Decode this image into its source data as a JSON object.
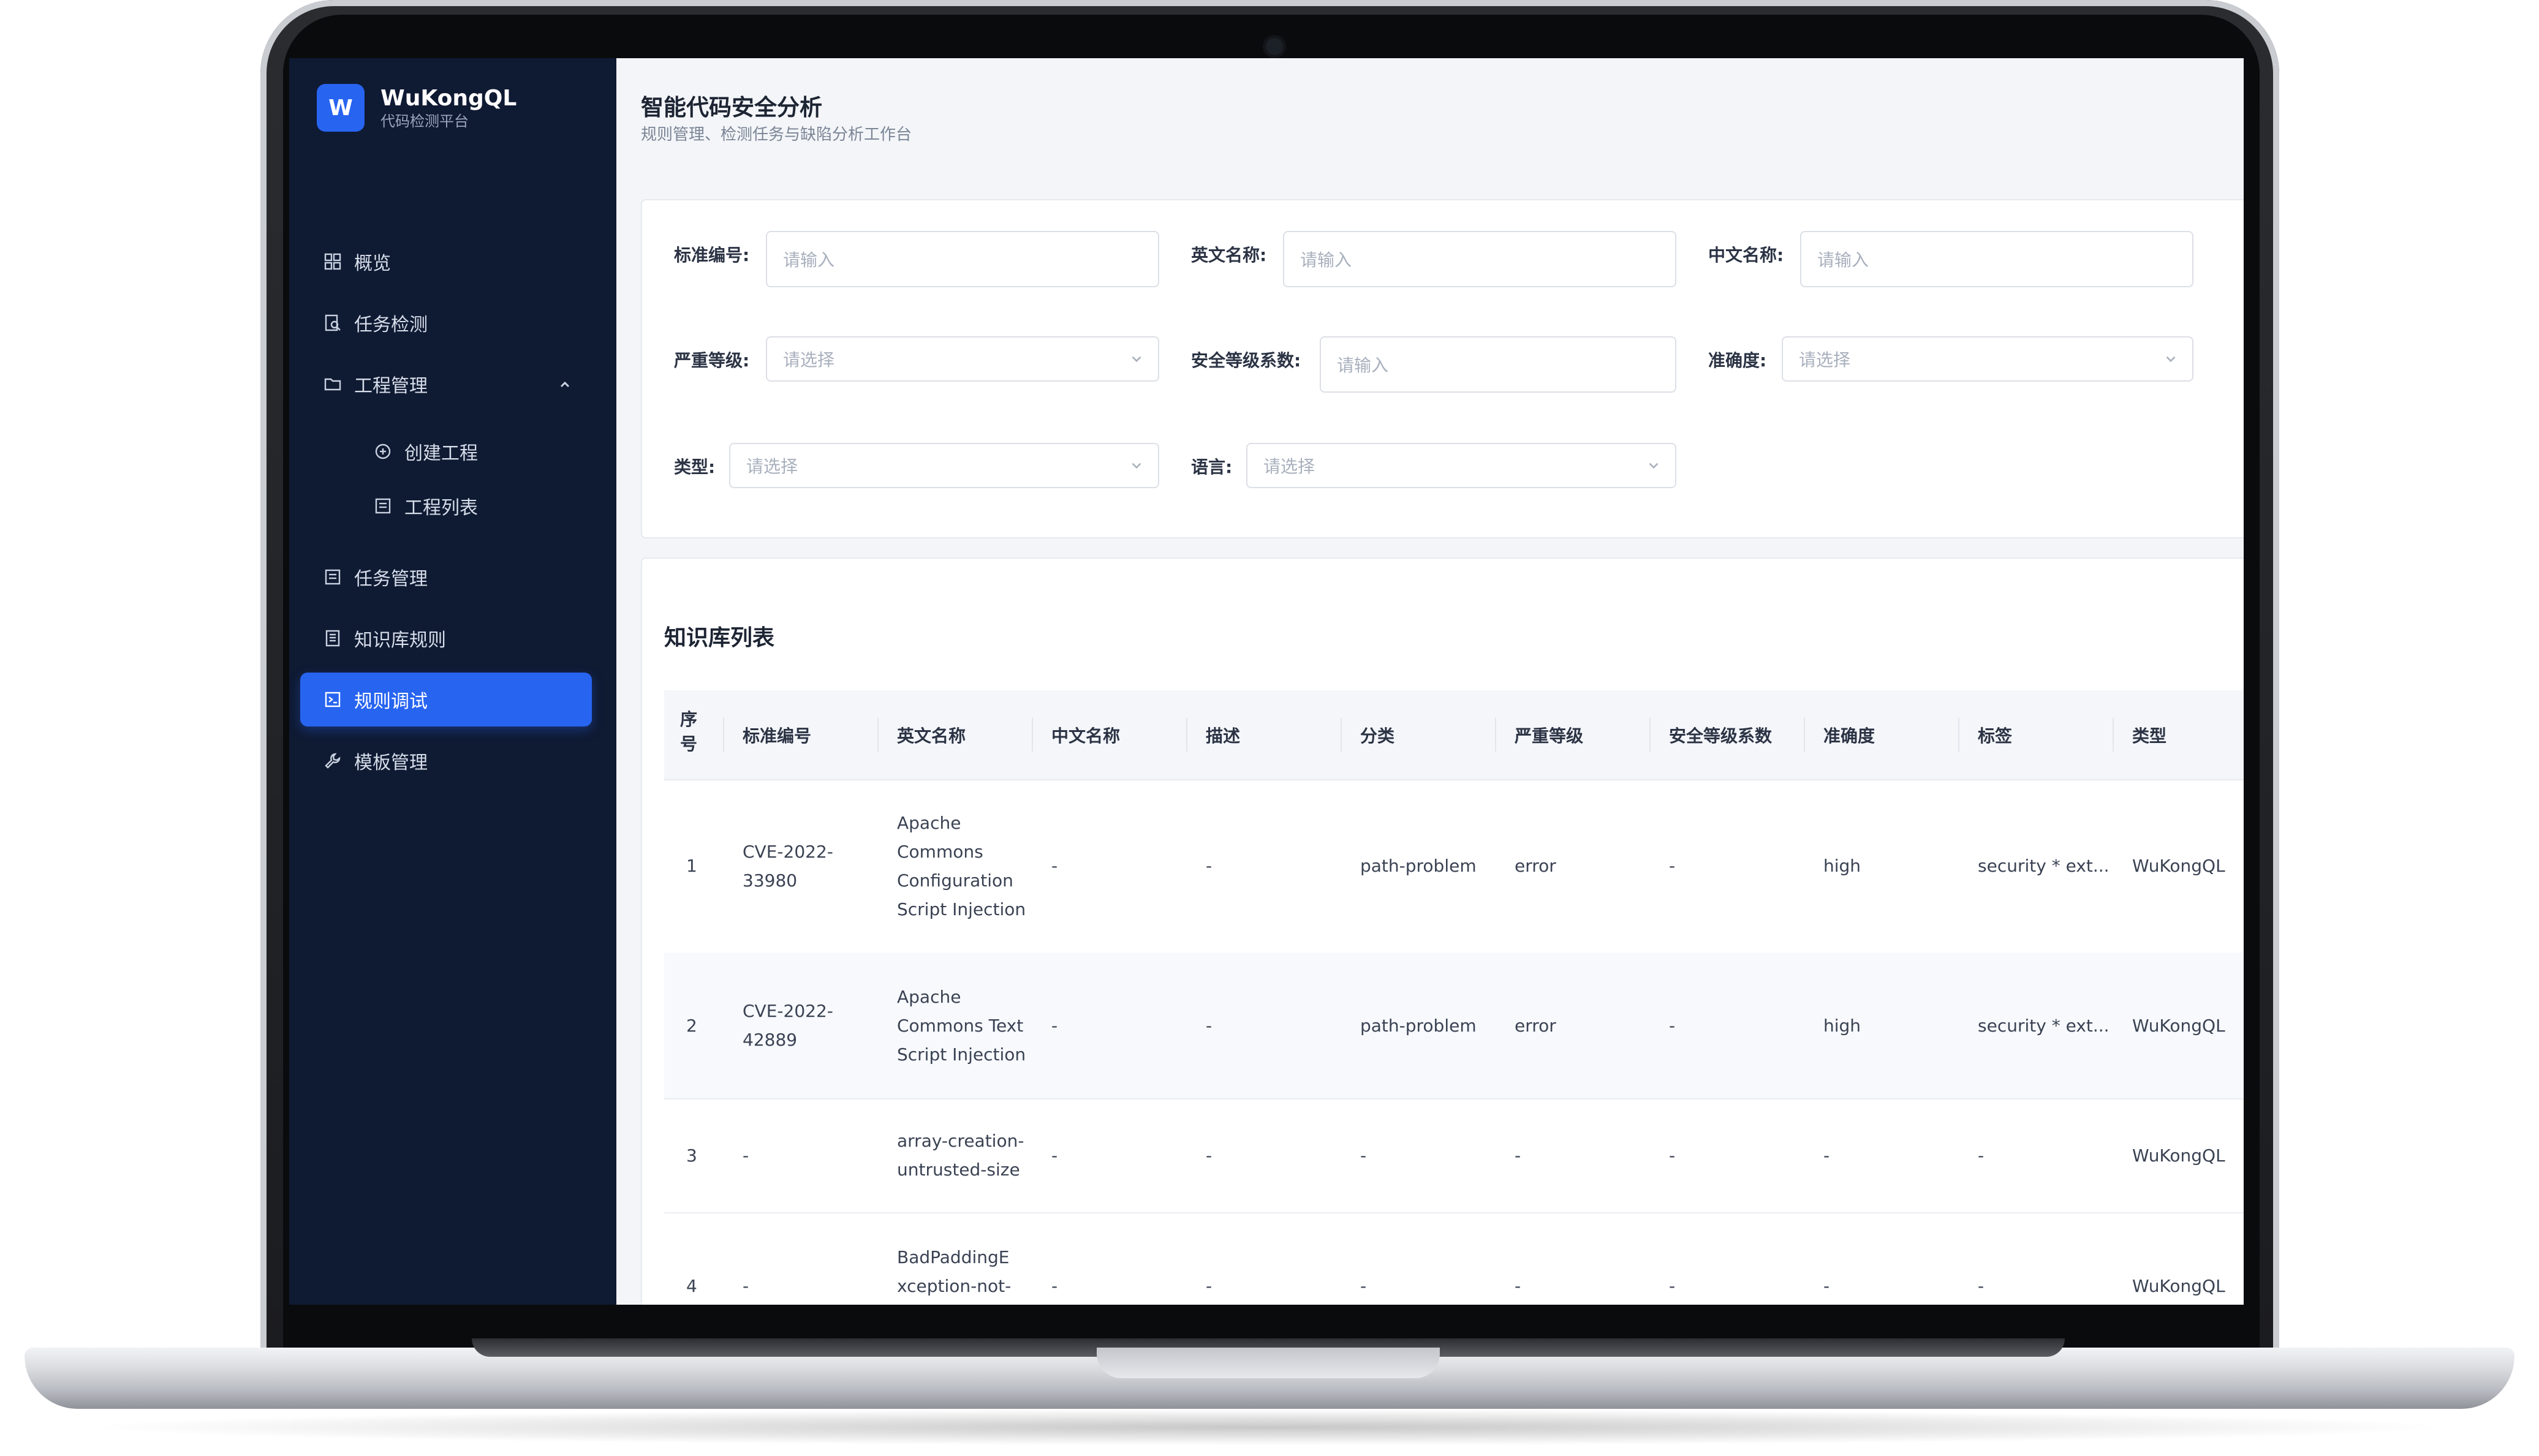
{
  "app": {
    "logo_letter": "W",
    "name": "WuKongQL",
    "subtitle": "代码检测平台"
  },
  "sidebar": {
    "items": [
      {
        "label": "概览",
        "icon": "grid-icon"
      },
      {
        "label": "任务检测",
        "icon": "task-search-icon"
      },
      {
        "label": "工程管理",
        "icon": "folder-icon",
        "expanded": true
      },
      {
        "label": "创建工程",
        "icon": "plus-circle-icon",
        "sub": true
      },
      {
        "label": "工程列表",
        "icon": "list-icon",
        "sub": true
      },
      {
        "label": "任务管理",
        "icon": "list-icon"
      },
      {
        "label": "知识库规则",
        "icon": "book-icon"
      },
      {
        "label": "规则调试",
        "icon": "terminal-icon",
        "active": true
      },
      {
        "label": "模板管理",
        "icon": "wrench-icon"
      }
    ]
  },
  "header": {
    "title": "智能代码安全分析",
    "subtitle": "规则管理、检测任务与缺陷分析工作台"
  },
  "filters": {
    "standard_id": {
      "label": "标准编号:",
      "placeholder": "请输入"
    },
    "english_name": {
      "label": "英文名称:",
      "placeholder": "请输入"
    },
    "chinese_name": {
      "label": "中文名称:",
      "placeholder": "请输入"
    },
    "severity": {
      "label": "严重等级:",
      "placeholder": "请选择"
    },
    "security_factor": {
      "label": "安全等级系数:",
      "placeholder": "请输入"
    },
    "precision": {
      "label": "准确度:",
      "placeholder": "请选择"
    },
    "type": {
      "label": "类型:",
      "placeholder": "请选择"
    },
    "language": {
      "label": "语言:",
      "placeholder": "请选择"
    }
  },
  "table": {
    "title": "知识库列表",
    "columns": [
      "序号",
      "标准编号",
      "英文名称",
      "中文名称",
      "描述",
      "分类",
      "严重等级",
      "安全等级系数",
      "准确度",
      "标签",
      "类型"
    ],
    "rows": [
      [
        "1",
        "CVE-2022-33980",
        "Apache Commons Configuration Script Injection",
        "-",
        "-",
        "path-problem",
        "error",
        "-",
        "high",
        "security * ext...",
        "WuKongQL"
      ],
      [
        "2",
        "CVE-2022-42889",
        "Apache Commons Text Script Injection",
        "-",
        "-",
        "path-problem",
        "error",
        "-",
        "high",
        "security * ext...",
        "WuKongQL"
      ],
      [
        "3",
        "-",
        "array-creation-untrusted-size",
        "-",
        "-",
        "-",
        "-",
        "-",
        "-",
        "-",
        "WuKongQL"
      ],
      [
        "4",
        "-",
        "BadPaddingException-not-properly-",
        "-",
        "-",
        "-",
        "-",
        "-",
        "-",
        "-",
        "WuKongQL"
      ]
    ]
  },
  "colors": {
    "sidebar_bg": "#0f1a33",
    "accent": "#2764f0",
    "page_bg": "#f3f5f8"
  }
}
